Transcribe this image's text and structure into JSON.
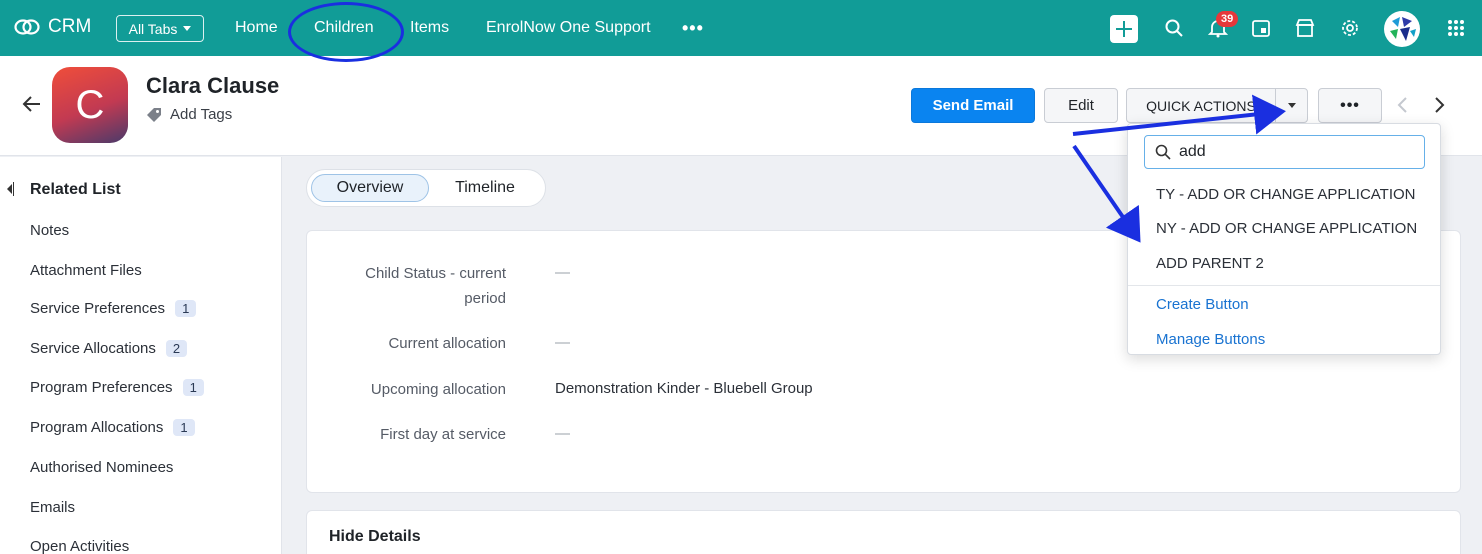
{
  "topbar": {
    "brand": "CRM",
    "all_tabs": "All Tabs",
    "nav": [
      "Home",
      "Children",
      "Items",
      "EnrolNow One Support"
    ],
    "notification_count": "39",
    "color": "#119c97"
  },
  "record": {
    "initial": "C",
    "name": "Clara Clause",
    "add_tags": "Add Tags"
  },
  "actions": {
    "send_email": "Send Email",
    "edit": "Edit",
    "quick_actions": "QUICK ACTIONS",
    "more": "•••"
  },
  "sidebar": {
    "heading": "Related List",
    "items": [
      {
        "label": "Notes",
        "count": ""
      },
      {
        "label": "Attachment Files",
        "count": ""
      },
      {
        "label": "Service Preferences",
        "count": "1"
      },
      {
        "label": "Service Allocations",
        "count": "2"
      },
      {
        "label": "Program Preferences",
        "count": "1"
      },
      {
        "label": "Program Allocations",
        "count": "1"
      },
      {
        "label": "Authorised Nominees",
        "count": ""
      },
      {
        "label": "Emails",
        "count": ""
      },
      {
        "label": "Open Activities",
        "count": ""
      }
    ]
  },
  "tabs": [
    "Overview",
    "Timeline"
  ],
  "fields": [
    {
      "label_line1": "Child Status - current",
      "label_line2": "period",
      "value": "—"
    },
    {
      "label_line1": "Current allocation",
      "label_line2": "",
      "value": "—"
    },
    {
      "label_line1": "Upcoming allocation",
      "label_line2": "",
      "value": "Demonstration Kinder - Bluebell Group"
    },
    {
      "label_line1": "First day at service",
      "label_line2": "",
      "value": "—"
    }
  ],
  "hide_details": "Hide Details",
  "dropdown": {
    "search_value": "add",
    "items": [
      "TY - ADD OR CHANGE APPLICATION",
      "NY - ADD OR CHANGE APPLICATION",
      "ADD PARENT 2"
    ],
    "links": [
      "Create Button",
      "Manage Buttons"
    ]
  },
  "annotation_color": "#1a2fe0"
}
